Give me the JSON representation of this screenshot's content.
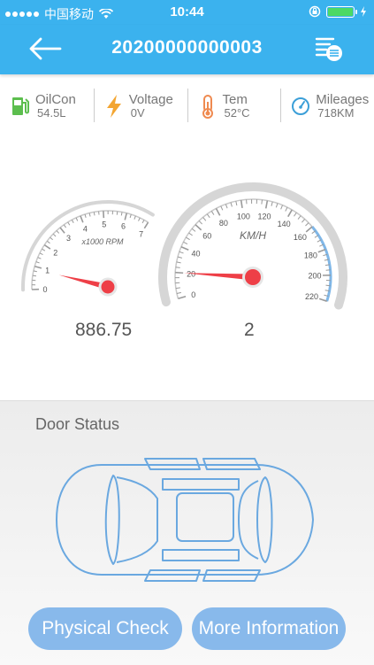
{
  "status": {
    "carrier": "中国移动",
    "time": "10:44"
  },
  "nav": {
    "title": "20200000000003"
  },
  "info": [
    {
      "label": "OilCon",
      "value": "54.5L",
      "icon": "fuel-icon",
      "color": "#5cbe4e"
    },
    {
      "label": "Voltage",
      "value": "0V",
      "icon": "lightning-icon",
      "color": "#f3a531"
    },
    {
      "label": "Tem",
      "value": "52°C",
      "icon": "thermometer-icon",
      "color": "#ef8a50"
    },
    {
      "label": "Mileages",
      "value": "718KM",
      "icon": "speedometer-icon",
      "color": "#3b9fd8"
    }
  ],
  "rpm": {
    "unit": "x1000 RPM",
    "ticks": [
      "0",
      "1",
      "2",
      "3",
      "4",
      "5",
      "6",
      "7"
    ],
    "reading": "886.75"
  },
  "speed": {
    "unit": "KM/H",
    "ticks": [
      "0",
      "20",
      "40",
      "60",
      "80",
      "100",
      "120",
      "140",
      "160",
      "180",
      "200",
      "220"
    ],
    "reading": "2"
  },
  "door": {
    "title": "Door Status"
  },
  "buttons": {
    "physical": "Physical Check",
    "more": "More Information"
  }
}
